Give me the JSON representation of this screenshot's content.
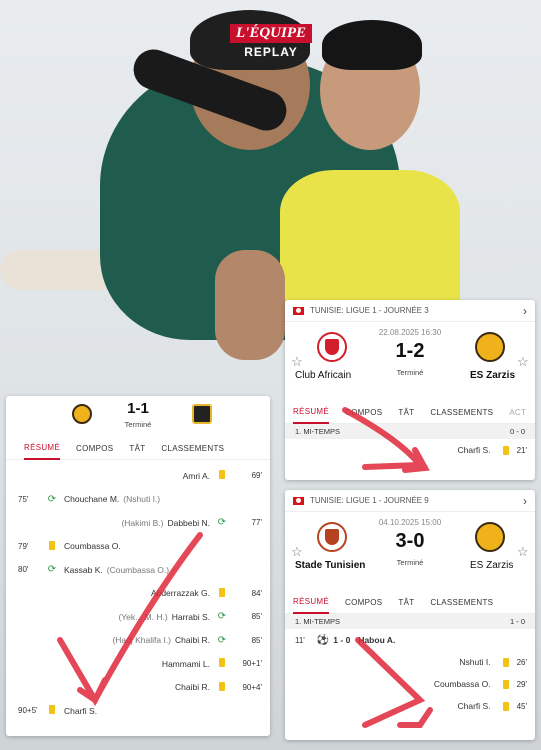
{
  "logo": {
    "brand": "L'ÉQUIPE",
    "sub": "REPLAY"
  },
  "card_top_right": {
    "competition": "TUNISIE: LIGUE 1 - JOURNÉE 3",
    "datetime": "22.08.2025 16:30",
    "home": "Club Africain",
    "away": "ES Zarzis",
    "score": "1-2",
    "status": "Terminé",
    "tabs": [
      "RÉSUMÉ",
      "COMPOS",
      "TÂT",
      "CLASSEMENTS",
      "ACT"
    ],
    "section": {
      "label": "1. MI-TEMPS",
      "score": "0 - 0"
    },
    "events": [
      {
        "player": "Charfi S.",
        "minute": "21'"
      }
    ]
  },
  "card_bottom_right": {
    "competition": "TUNISIE: LIGUE 1 - JOURNÉE 9",
    "datetime": "04.10.2025 15:00",
    "home": "Stade Tunisien",
    "away": "ES Zarzis",
    "score": "3-0",
    "status": "Terminé",
    "tabs": [
      "RÉSUMÉ",
      "COMPOS",
      "TÂT",
      "CLASSEMENTS"
    ],
    "section": {
      "label": "1. MI-TEMPS",
      "score": "1 - 0"
    },
    "goal": {
      "minute": "11'",
      "score": "1 - 0",
      "player": "Habou A."
    },
    "events": [
      {
        "player": "Nshuti I.",
        "minute": "26'"
      },
      {
        "player": "Coumbassa O.",
        "minute": "29'"
      },
      {
        "player": "Charfi S.",
        "minute": "45'"
      }
    ]
  },
  "card_left": {
    "score": "1-1",
    "status": "Terminé",
    "tabs": [
      "RÉSUMÉ",
      "COMPOS",
      "TÂT",
      "CLASSEMENTS"
    ],
    "events": [
      {
        "side": "right",
        "type": "yellow",
        "player": "Amri A.",
        "minute": "69'"
      },
      {
        "side": "left",
        "type": "sub",
        "minute": "75'",
        "player": "Chouchane M.",
        "detail": "(Nshuti I.)"
      },
      {
        "side": "right",
        "type": "sub",
        "minute": "77'",
        "player": "Dabbebi N.",
        "detail": "(Hakimi B.)"
      },
      {
        "side": "left",
        "type": "yellow",
        "minute": "79'",
        "player": "Coumbassa O."
      },
      {
        "side": "left",
        "type": "sub",
        "minute": "80'",
        "player": "Kassab K.",
        "detail": "(Coumbassa O.)"
      },
      {
        "side": "right",
        "type": "yellow",
        "player": "Abderrazzak G.",
        "minute": "84'"
      },
      {
        "side": "right",
        "type": "sub",
        "minute": "85'",
        "player": "Harrabi S.",
        "detail": "(Yek... M. H.)"
      },
      {
        "side": "right",
        "type": "sub",
        "minute": "85'",
        "player": "Chaibi R.",
        "detail": "(Hadj Khalifa I.)"
      },
      {
        "side": "right",
        "type": "yellow",
        "player": "Hammami L.",
        "minute": "90+1'"
      },
      {
        "side": "right",
        "type": "yellow",
        "player": "Chaibi R.",
        "minute": "90+4'"
      },
      {
        "side": "left",
        "type": "yellow",
        "minute": "90+5'",
        "player": "Charfi S."
      }
    ]
  },
  "colors": {
    "accent": "#c8102e",
    "yellow_card": "#f2c314",
    "arrow": "#e0283a"
  }
}
